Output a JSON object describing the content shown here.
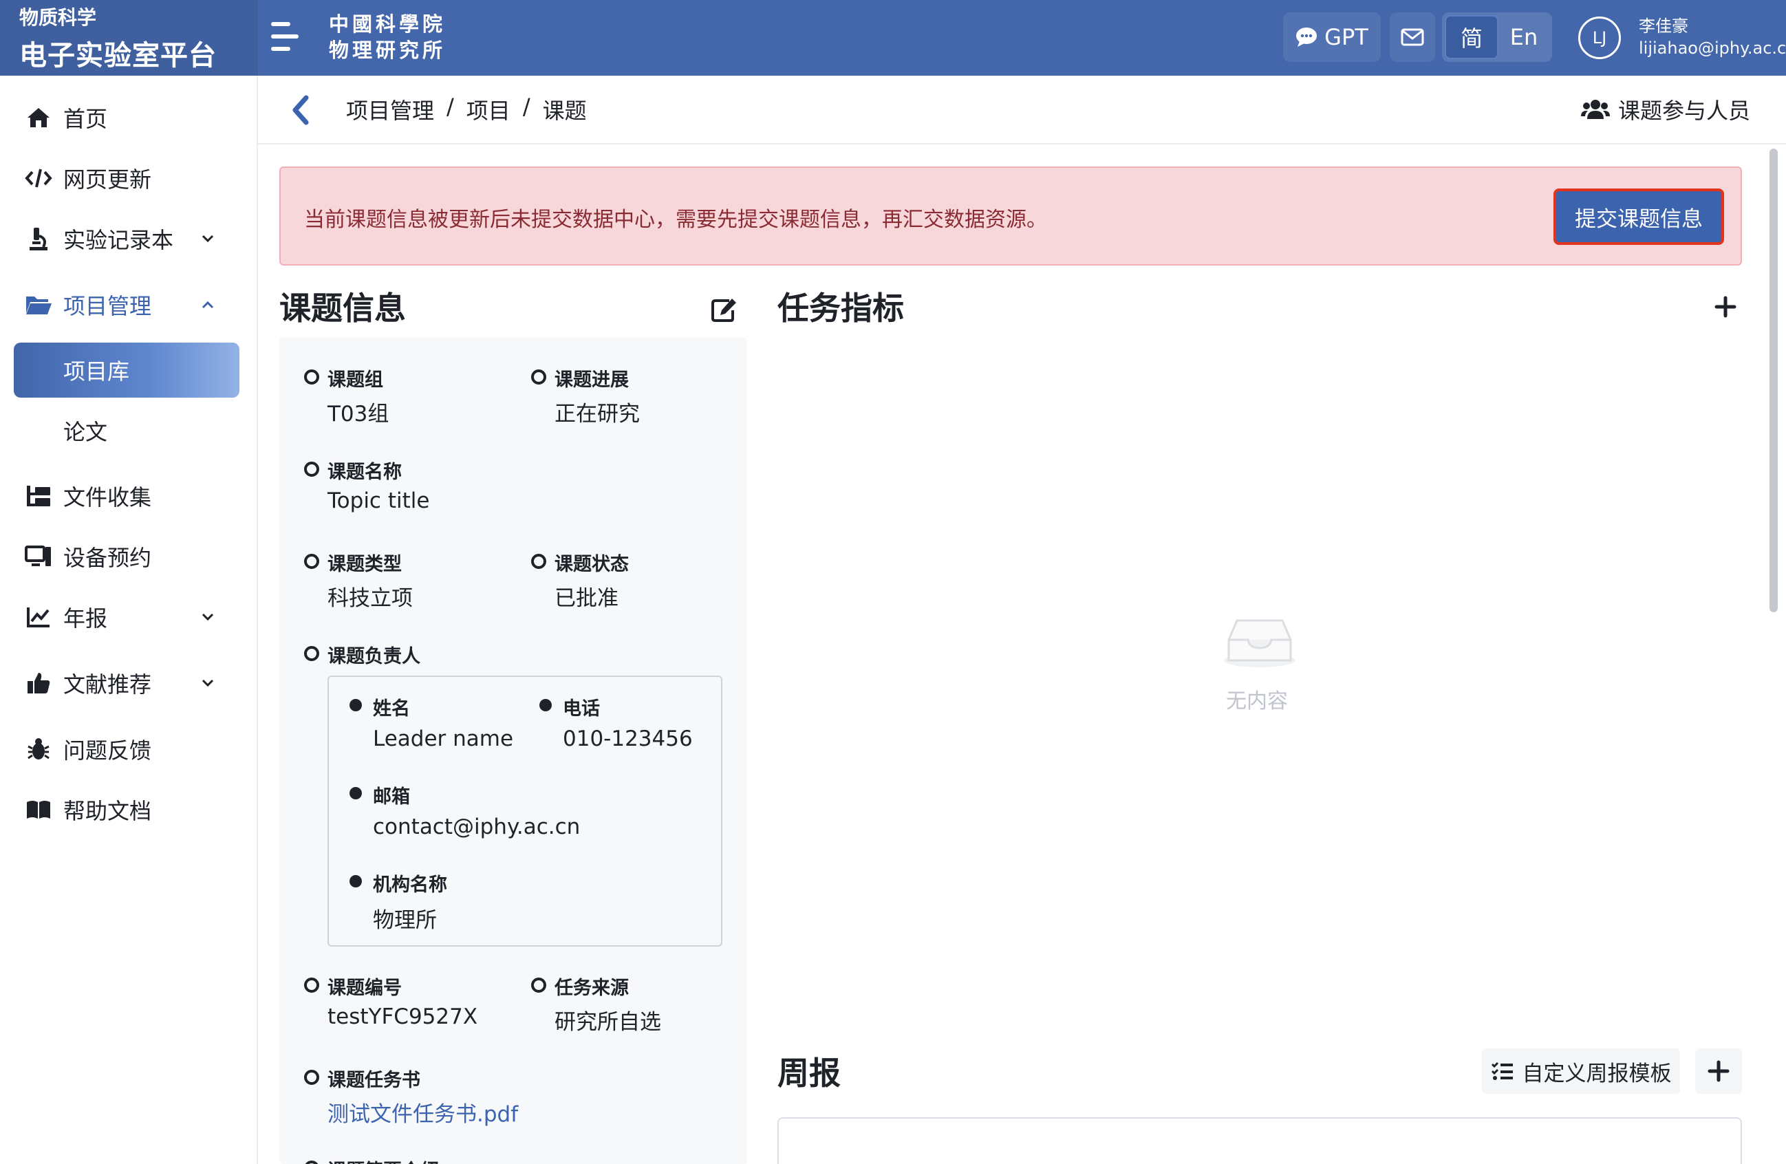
{
  "brand": {
    "sub": "物质科学",
    "main": "电子实验室平台"
  },
  "institute": {
    "line1": "中國科學院",
    "line2": "物理研究所"
  },
  "topbar": {
    "gpt_label": "GPT",
    "lang_zh": "简",
    "lang_en": "En",
    "user_initials": "LJ",
    "user_name": "李佳豪",
    "user_email": "lijiahao@iphy.ac.cn"
  },
  "sidebar": {
    "home": "首页",
    "web_update": "网页更新",
    "lab_notebook": "实验记录本",
    "project_mgmt": "项目管理",
    "project_library": "项目库",
    "papers": "论文",
    "file_collection": "文件收集",
    "device_booking": "设备预约",
    "annual_report": "年报",
    "literature": "文献推荐",
    "feedback": "问题反馈",
    "help_docs": "帮助文档"
  },
  "breadcrumb": {
    "level1": "项目管理",
    "level2": "项目",
    "level3": "课题",
    "separator": "/"
  },
  "members_label": "课题参与人员",
  "alert": {
    "message": "当前课题信息被更新后未提交数据中心，需要先提交课题信息，再汇交数据资源。",
    "submit_label": "提交课题信息"
  },
  "topic_info": {
    "title": "课题信息",
    "group_label": "课题组",
    "group_value": "T03组",
    "progress_label": "课题进展",
    "progress_value": "正在研究",
    "name_label": "课题名称",
    "name_value": "Topic title",
    "type_label": "课题类型",
    "type_value": "科技立项",
    "status_label": "课题状态",
    "status_value": "已批准",
    "leader_label": "课题负责人",
    "leader": {
      "name_label": "姓名",
      "name_value": "Leader name",
      "phone_label": "电话",
      "phone_value": "010-123456",
      "email_label": "邮箱",
      "email_value": "contact@iphy.ac.cn",
      "org_label": "机构名称",
      "org_value": "物理所"
    },
    "code_label": "课题编号",
    "code_value": "testYFC9527X",
    "source_label": "任务来源",
    "source_value": "研究所自选",
    "taskbook_label": "课题任务书",
    "taskbook_value": "测试文件任务书.pdf",
    "brief_label": "课题简要介绍"
  },
  "task_targets": {
    "title": "任务指标",
    "empty_text": "无内容"
  },
  "weekly": {
    "title": "周报",
    "template_label": "自定义周报模板"
  },
  "colors": {
    "topbar": "#4467ab",
    "accent": "#3c63ad",
    "alert_bg": "#f8d7da",
    "alert_text": "#8a2a33",
    "highlight_border": "#e0341f"
  }
}
